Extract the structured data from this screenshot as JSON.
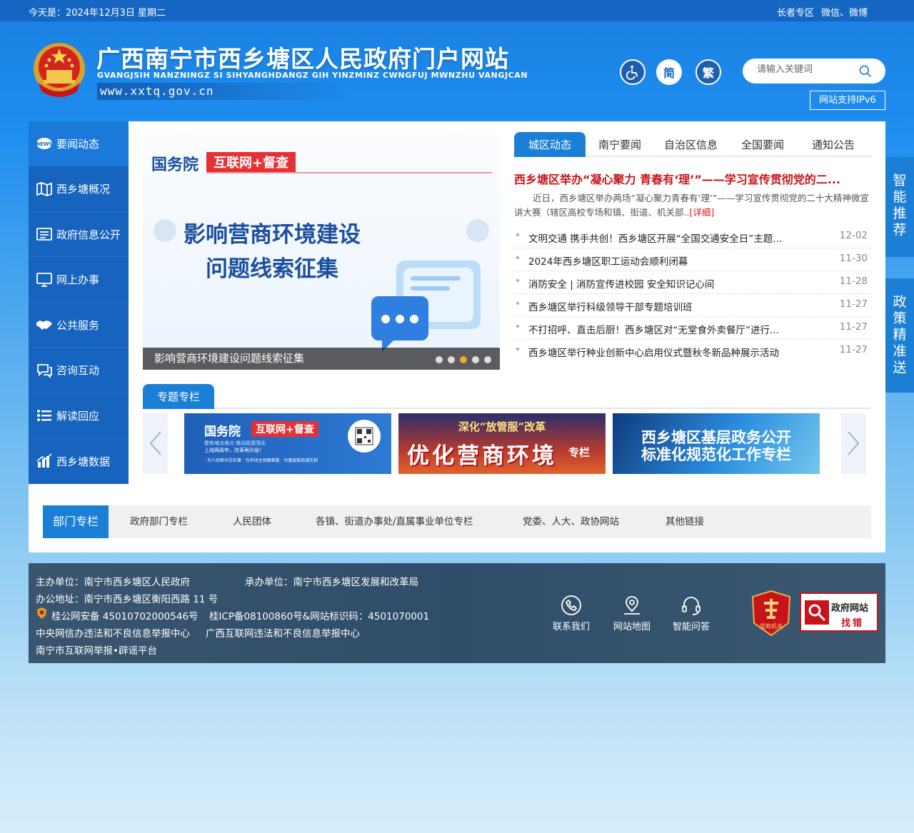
{
  "topbar": {
    "date": "今天是：2024年12月3日 星期二",
    "links": [
      "长者专区",
      "微信、微博"
    ]
  },
  "header": {
    "title": "广西南宁市西乡塘区人民政府门户网站",
    "pinyin": "GVANGJSIH NANZNINGZ SI SIHYANGHDANGZ GIH YINZMINZ CWNGFUJ MWNZHU VANGJCAN",
    "url": "www.xxtq.gov.cn",
    "simplified": "简",
    "traditional": "繁",
    "search_placeholder": "请输入关键词",
    "ipv6": "网站支持IPv6"
  },
  "sidenav": [
    {
      "label": "要闻动态",
      "icon": "news-icon"
    },
    {
      "label": "西乡塘概况",
      "icon": "map-icon"
    },
    {
      "label": "政府信息公开",
      "icon": "info-list-icon"
    },
    {
      "label": "网上办事",
      "icon": "monitor-icon"
    },
    {
      "label": "公共服务",
      "icon": "handshake-icon"
    },
    {
      "label": "咨询互动",
      "icon": "chat-icon"
    },
    {
      "label": "解读回应",
      "icon": "list-icon"
    },
    {
      "label": "西乡塘数据",
      "icon": "chart-icon"
    }
  ],
  "banner": {
    "brand": "国务院",
    "tag": "互联网+督查",
    "headline_line1": "影响营商环境建设",
    "headline_line2": "问题线索征集",
    "caption": "影响营商环境建设问题线索征集",
    "active_dot": 3
  },
  "news": {
    "tabs": [
      "城区动态",
      "南宁要闻",
      "自治区信息",
      "全国要闻",
      "通知公告"
    ],
    "headline": "西乡塘区举办“凝心聚力 青春有‘理’”——学习宣传贯彻党的二...",
    "summary": "近日，西乡塘区举办两场“凝心聚力青春有‘理’”——学习宣传贯彻党的二十大精神微宣讲大赛（辖区高校专场和镇、街道、机关部..",
    "summary_more": "[详细]",
    "items": [
      {
        "title": "文明交通 携手共创！西乡塘区开展“全国交通安全日”主题...",
        "date": "12-02"
      },
      {
        "title": "2024年西乡塘区职工运动会顺利闭幕",
        "date": "11-30"
      },
      {
        "title": "消防安全 | 消防宣传进校园 安全知识记心间",
        "date": "11-28"
      },
      {
        "title": "西乡塘区举行科级领导干部专题培训班",
        "date": "11-27"
      },
      {
        "title": "不打招呼、直击后厨！西乡塘区对“无堂食外卖餐厅”进行...",
        "date": "11-27"
      },
      {
        "title": "西乡塘区举行种业创新中心启用仪式暨秋冬新品种展示活动",
        "date": "11-27"
      }
    ]
  },
  "special": {
    "tab": "专题专栏",
    "card1": {
      "brand": "国务院",
      "tag": "互联网+督查",
      "sub1": "聚焦堵点难点 推动政策落实",
      "sub2": "上线两周年，改革再升级！",
      "sub3": "· 为人民群众办实事    · 为市场主体解难题    · 为基层政府减负担"
    },
    "card2": {
      "line1": "深化“放管服”改革",
      "line2": "优化营商环境",
      "suffix": "专栏"
    },
    "card3": {
      "line1": "西乡塘区基层政务公开",
      "line2": "标准化规范化工作专栏"
    }
  },
  "departments": {
    "tabs": [
      "部门专栏",
      "政府部门专栏",
      "人民团体",
      "各镇、街道办事处/直属事业单位专栏",
      "党委、人大、政协网站",
      "其他链接"
    ]
  },
  "footer": {
    "host": "主办单位：南宁市西乡塘区人民政府",
    "organizer": "承办单位：南宁市西乡塘区发展和改革局",
    "address": "办公地址：南宁市西乡塘区衡阳西路 11 号",
    "police": "桂公网安备 45010702000546号",
    "icp": "桂ICP备08100860号&网站标识码：4501070001",
    "report1": "中央网信办违法和不良信息举报中心",
    "report2": "广西互联网违法和不良信息举报中心",
    "report3": "南宁市互联网举报•辟谣平台",
    "contact": "联系我们",
    "sitemap": "网站地图",
    "qa": "智能问答",
    "party_badge": "党政机关",
    "error_find_line1": "政府网站",
    "error_find_line2": "找错"
  },
  "side_float": {
    "recommend": "智能推荐",
    "policy": "政策精准送"
  },
  "colors": {
    "primary": "#1c7fd6",
    "nav": "#1664bd",
    "headline": "#c6141a",
    "accent": "#f5a623"
  }
}
